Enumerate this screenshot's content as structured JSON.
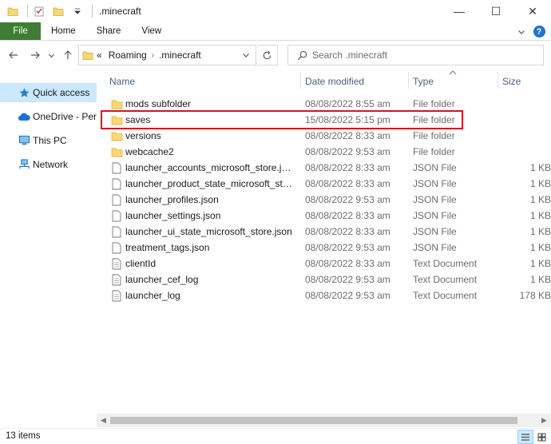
{
  "window": {
    "title": ".minecraft",
    "controls": {
      "minimize": "—",
      "maximize": "☐",
      "close": "✕"
    }
  },
  "ribbon": {
    "tabs": [
      "File",
      "Home",
      "Share",
      "View"
    ]
  },
  "address": {
    "overflow": "«",
    "crumbs": [
      "Roaming",
      ".minecraft"
    ]
  },
  "search": {
    "placeholder": "Search .minecraft"
  },
  "sidebar": {
    "items": [
      {
        "label": "Quick access",
        "icon": "star-icon",
        "active": true
      },
      {
        "label": "OneDrive - Personal",
        "icon": "cloud-icon",
        "active": false
      },
      {
        "label": "This PC",
        "icon": "computer-icon",
        "active": false
      },
      {
        "label": "Network",
        "icon": "network-icon",
        "active": false
      }
    ]
  },
  "columns": [
    "Name",
    "Date modified",
    "Type",
    "Size"
  ],
  "files": [
    {
      "name": "mods subfolder",
      "date": "08/08/2022 8:55 am",
      "type": "File folder",
      "size": "",
      "icon": "folder-icon"
    },
    {
      "name": "saves",
      "date": "15/08/2022 5:15 pm",
      "type": "File folder",
      "size": "",
      "icon": "folder-icon"
    },
    {
      "name": "versions",
      "date": "08/08/2022 8:33 am",
      "type": "File folder",
      "size": "",
      "icon": "folder-icon"
    },
    {
      "name": "webcache2",
      "date": "08/08/2022 9:53 am",
      "type": "File folder",
      "size": "",
      "icon": "folder-icon"
    },
    {
      "name": "launcher_accounts_microsoft_store.json",
      "date": "08/08/2022 8:33 am",
      "type": "JSON File",
      "size": "1 KB",
      "icon": "file-icon"
    },
    {
      "name": "launcher_product_state_microsoft_store.json",
      "date": "08/08/2022 8:33 am",
      "type": "JSON File",
      "size": "1 KB",
      "icon": "file-icon"
    },
    {
      "name": "launcher_profiles.json",
      "date": "08/08/2022 9:53 am",
      "type": "JSON File",
      "size": "1 KB",
      "icon": "file-icon"
    },
    {
      "name": "launcher_settings.json",
      "date": "08/08/2022 8:33 am",
      "type": "JSON File",
      "size": "1 KB",
      "icon": "file-icon"
    },
    {
      "name": "launcher_ui_state_microsoft_store.json",
      "date": "08/08/2022 8:33 am",
      "type": "JSON File",
      "size": "1 KB",
      "icon": "file-icon"
    },
    {
      "name": "treatment_tags.json",
      "date": "08/08/2022 9:53 am",
      "type": "JSON File",
      "size": "1 KB",
      "icon": "file-icon"
    },
    {
      "name": "clientId",
      "date": "08/08/2022 8:33 am",
      "type": "Text Document",
      "size": "1 KB",
      "icon": "text-file-icon"
    },
    {
      "name": "launcher_cef_log",
      "date": "08/08/2022 9:53 am",
      "type": "Text Document",
      "size": "1 KB",
      "icon": "text-file-icon"
    },
    {
      "name": "launcher_log",
      "date": "08/08/2022 9:53 am",
      "type": "Text Document",
      "size": "178 KB",
      "icon": "text-file-icon"
    }
  ],
  "status": {
    "item_count": "13 items"
  },
  "colors": {
    "file_tab": "#3f7d34",
    "selection": "#cce8ff",
    "highlight_box": "#d3151f",
    "folder": "#f8d775"
  }
}
